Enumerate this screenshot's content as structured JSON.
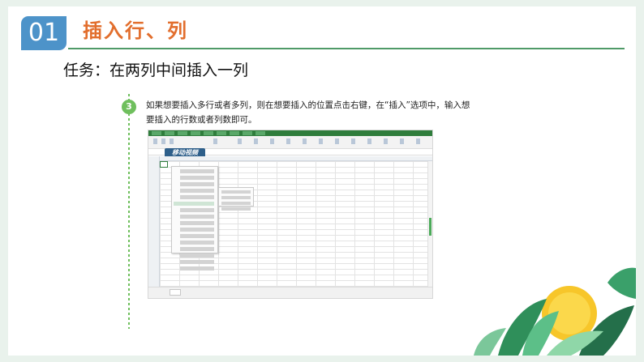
{
  "section": {
    "number": "01",
    "title": "插入行、列"
  },
  "task": {
    "title": "任务：在两列中间插入一列"
  },
  "step": {
    "number": "3",
    "text_line1": "如果想要插入多行或者多列，则在想要插入的位置点击右键，在“插入”选项中，输入想",
    "text_line2": "要插入的行数或者列数即可。"
  },
  "screenshot": {
    "logo_text": "移动视频"
  },
  "colors": {
    "badge_blue": "#4d93c9",
    "title_orange": "#e26e2d",
    "rule_green": "#4f9a68",
    "step_green": "#6fbf5d"
  }
}
